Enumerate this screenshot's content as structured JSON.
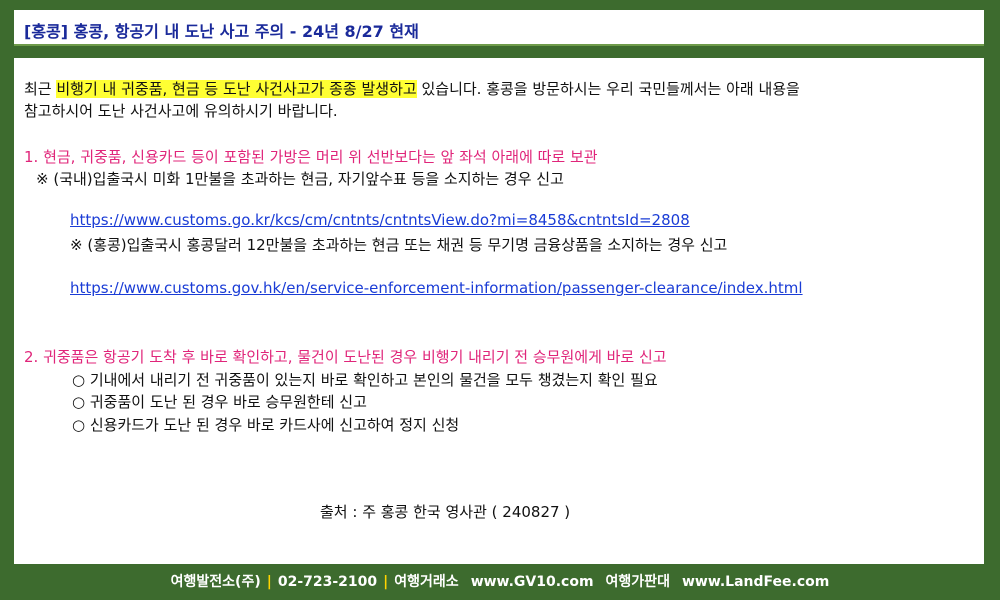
{
  "title": "[홍콩] 홍콩, 항공기 내 도난 사고 주의 - 24년 8/27 현재",
  "intro": {
    "prefix": "최근 ",
    "highlight": "비행기 내 귀중품, 현금 등 도난 사건사고가 종종 발생하고",
    "suffix": " 있습니다. 홍콩을 방문하시는 우리 국민들께서는 아래 내용을",
    "line2": "참고하시어 도난 사건사고에 유의하시기 바랍니다."
  },
  "section1": {
    "heading": "1. 현금, 귀중품, 신용카드 등이 포함된 가방은 머리 위 선반보다는 앞 좌석 아래에 따로 보관",
    "note1": "※ (국내)입출국시 미화 1만불을 초과하는 현금, 자기앞수표 등을 소지하는 경우 신고",
    "link1": "https://www.customs.go.kr/kcs/cm/cntnts/cntntsView.do?mi=8458&cntntsId=2808",
    "note2": "※ (홍콩)입출국시 홍콩달러 12만불을 초과하는 현금 또는 채권 등 무기명 금융상품을 소지하는 경우 신고",
    "link2": "https://www.customs.gov.hk/en/service-enforcement-information/passenger-clearance/index.html"
  },
  "section2": {
    "heading": "2. 귀중품은 항공기 도착 후 바로 확인하고, 물건이 도난된 경우 비행기 내리기 전 승무원에게 바로 신고",
    "items": [
      "○ 기내에서 내리기 전 귀중품이 있는지 바로 확인하고 본인의 물건을 모두 챙겼는지 확인 필요",
      "○ 귀중품이 도난 된 경우 바로 승무원한테 신고",
      "○ 신용카드가 도난 된 경우 바로 카드사에 신고하여 정지 신청"
    ]
  },
  "source": "출처 : 주 홍콩 한국 영사관 ( 240827 )",
  "footer": {
    "company": "여행발전소(주)",
    "phone": "02-723-2100",
    "label1": "여행거래소",
    "site1": "www.GV10.com",
    "label2": "여행가판대",
    "site2": "www.LandFee.com",
    "separator": "|"
  },
  "colors": {
    "background": "#3d6b2e",
    "title_text": "#1a2a9a",
    "highlight": "#ffff33",
    "heading_pink": "#e0257a",
    "link": "#1a3cd6",
    "separator": "#ffd400"
  }
}
